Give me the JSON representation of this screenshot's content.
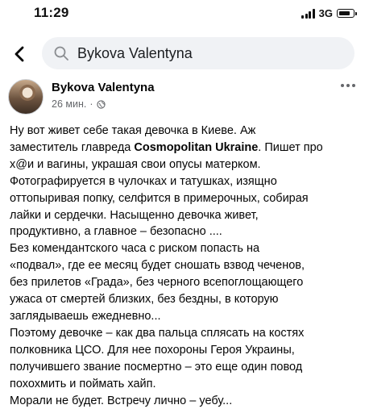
{
  "status_bar": {
    "time": "11:29",
    "network": "3G"
  },
  "search": {
    "query": "Bykova Valentyna"
  },
  "post": {
    "author": "Bykova Valentyna",
    "time_ago": "26 мин.",
    "separator": "·",
    "lines": [
      [
        "Ну вот живет себе такая девочка в Киеве. Аж"
      ],
      [
        "заместитель главреда ",
        "Cosmopolitan Ukraine",
        ". Пишет про"
      ],
      [
        "х@и и вагины, украшая свои опусы матерком."
      ],
      [
        "Фотографируется в чулочках и татушках, изящно"
      ],
      [
        "оттопыривая попку, селфится в примерочных, собирая"
      ],
      [
        "лайки и сердечки. Насыщенно девочка живет,"
      ],
      [
        "продуктивно, а главное – безопасно ...."
      ],
      [
        "Без комендантского часа с риском попасть на"
      ],
      [
        "«подвал», где ее  месяц будет сношать  взвод чеченов,"
      ],
      [
        "без прилетов «Града», без черного всепоглощающего"
      ],
      [
        "ужаса от смертей близких, без бездны, в которую"
      ],
      [
        "заглядываешь ежедневно..."
      ],
      [
        "Поэтому девочке – как два пальца сплясать на костях"
      ],
      [
        "полковника ЦСО. Для нее похороны Героя Украины,"
      ],
      [
        "получившего звание посмертно – это еще один повод"
      ],
      [
        "похохмить и поймать хайп."
      ],
      [
        "Морали не будет. Встречу лично – уебу..."
      ]
    ]
  }
}
